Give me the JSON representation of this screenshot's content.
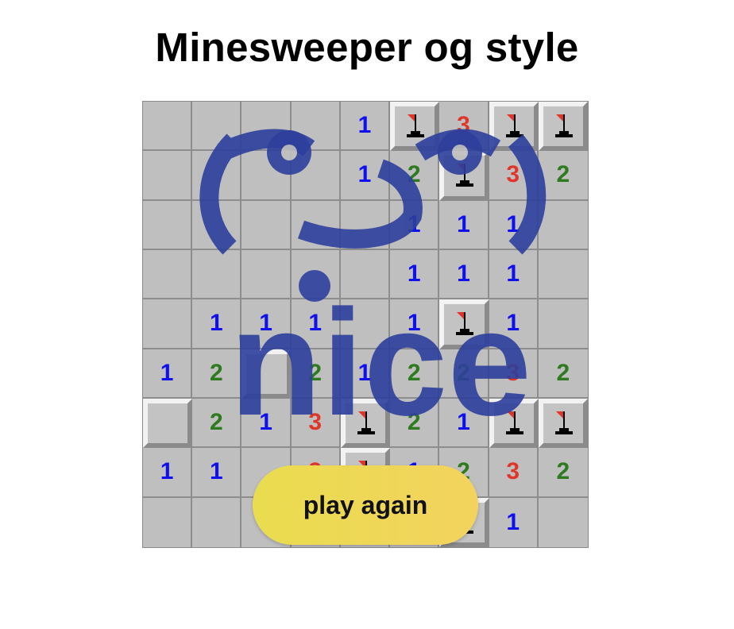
{
  "title": "Minesweeper og style",
  "overlay": {
    "face": "( ͡° ͜ʖ ͡°)",
    "word": "nice",
    "color": "#2d3f9c"
  },
  "colors": {
    "1": "#1010ee",
    "2": "#2d7a1f",
    "3": "#e0362a",
    "cell": "#c0bfc0",
    "button": "#efd854"
  },
  "board": [
    [
      "",
      "",
      "",
      "",
      "1",
      "flag",
      "3",
      "flag",
      "flag"
    ],
    [
      "",
      "",
      "",
      "",
      "1",
      "2",
      "flag",
      "3",
      "2"
    ],
    [
      "",
      "",
      "",
      "",
      "",
      "1",
      "1",
      "1",
      ""
    ],
    [
      "",
      "",
      "",
      "",
      "",
      "1",
      "1",
      "1",
      ""
    ],
    [
      "",
      "1",
      "1",
      "1",
      "",
      "1",
      "flag",
      "1",
      ""
    ],
    [
      "1",
      "2",
      "raised",
      "2",
      "1",
      "2",
      "2",
      "3",
      "2"
    ],
    [
      "raised",
      "2",
      "1",
      "3",
      "flag",
      "2",
      "1",
      "flag",
      "flag"
    ],
    [
      "1",
      "1",
      "",
      "3",
      "flag",
      "1",
      "2",
      "3",
      "2"
    ],
    [
      "",
      "",
      "",
      "",
      "",
      "",
      "flag",
      "1",
      ""
    ]
  ],
  "button": {
    "label": "play again"
  }
}
